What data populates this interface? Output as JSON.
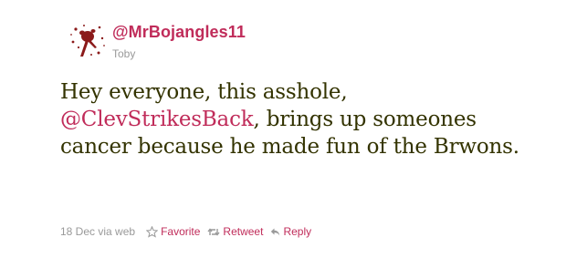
{
  "tweet": {
    "user": {
      "handle": "@MrBojangles11",
      "display_name": "Toby",
      "avatar_icon": "blood-splatter-avatar"
    },
    "text": {
      "before_mention": "Hey everyone, this asshole, ",
      "mention": "@ClevStrikesBack",
      "after_mention": ", brings up someones cancer because he made fun of the Brwons."
    },
    "meta": {
      "date": "18 Dec",
      "via": "via web",
      "actions": [
        {
          "label": "Favorite",
          "icon": "star-icon"
        },
        {
          "label": "Retweet",
          "icon": "retweet-icon"
        },
        {
          "label": "Reply",
          "icon": "reply-icon"
        }
      ]
    },
    "colors": {
      "link": "#c02c5a",
      "text": "#333300",
      "muted": "#999999",
      "avatar_blood": "#8b1a1a"
    }
  }
}
